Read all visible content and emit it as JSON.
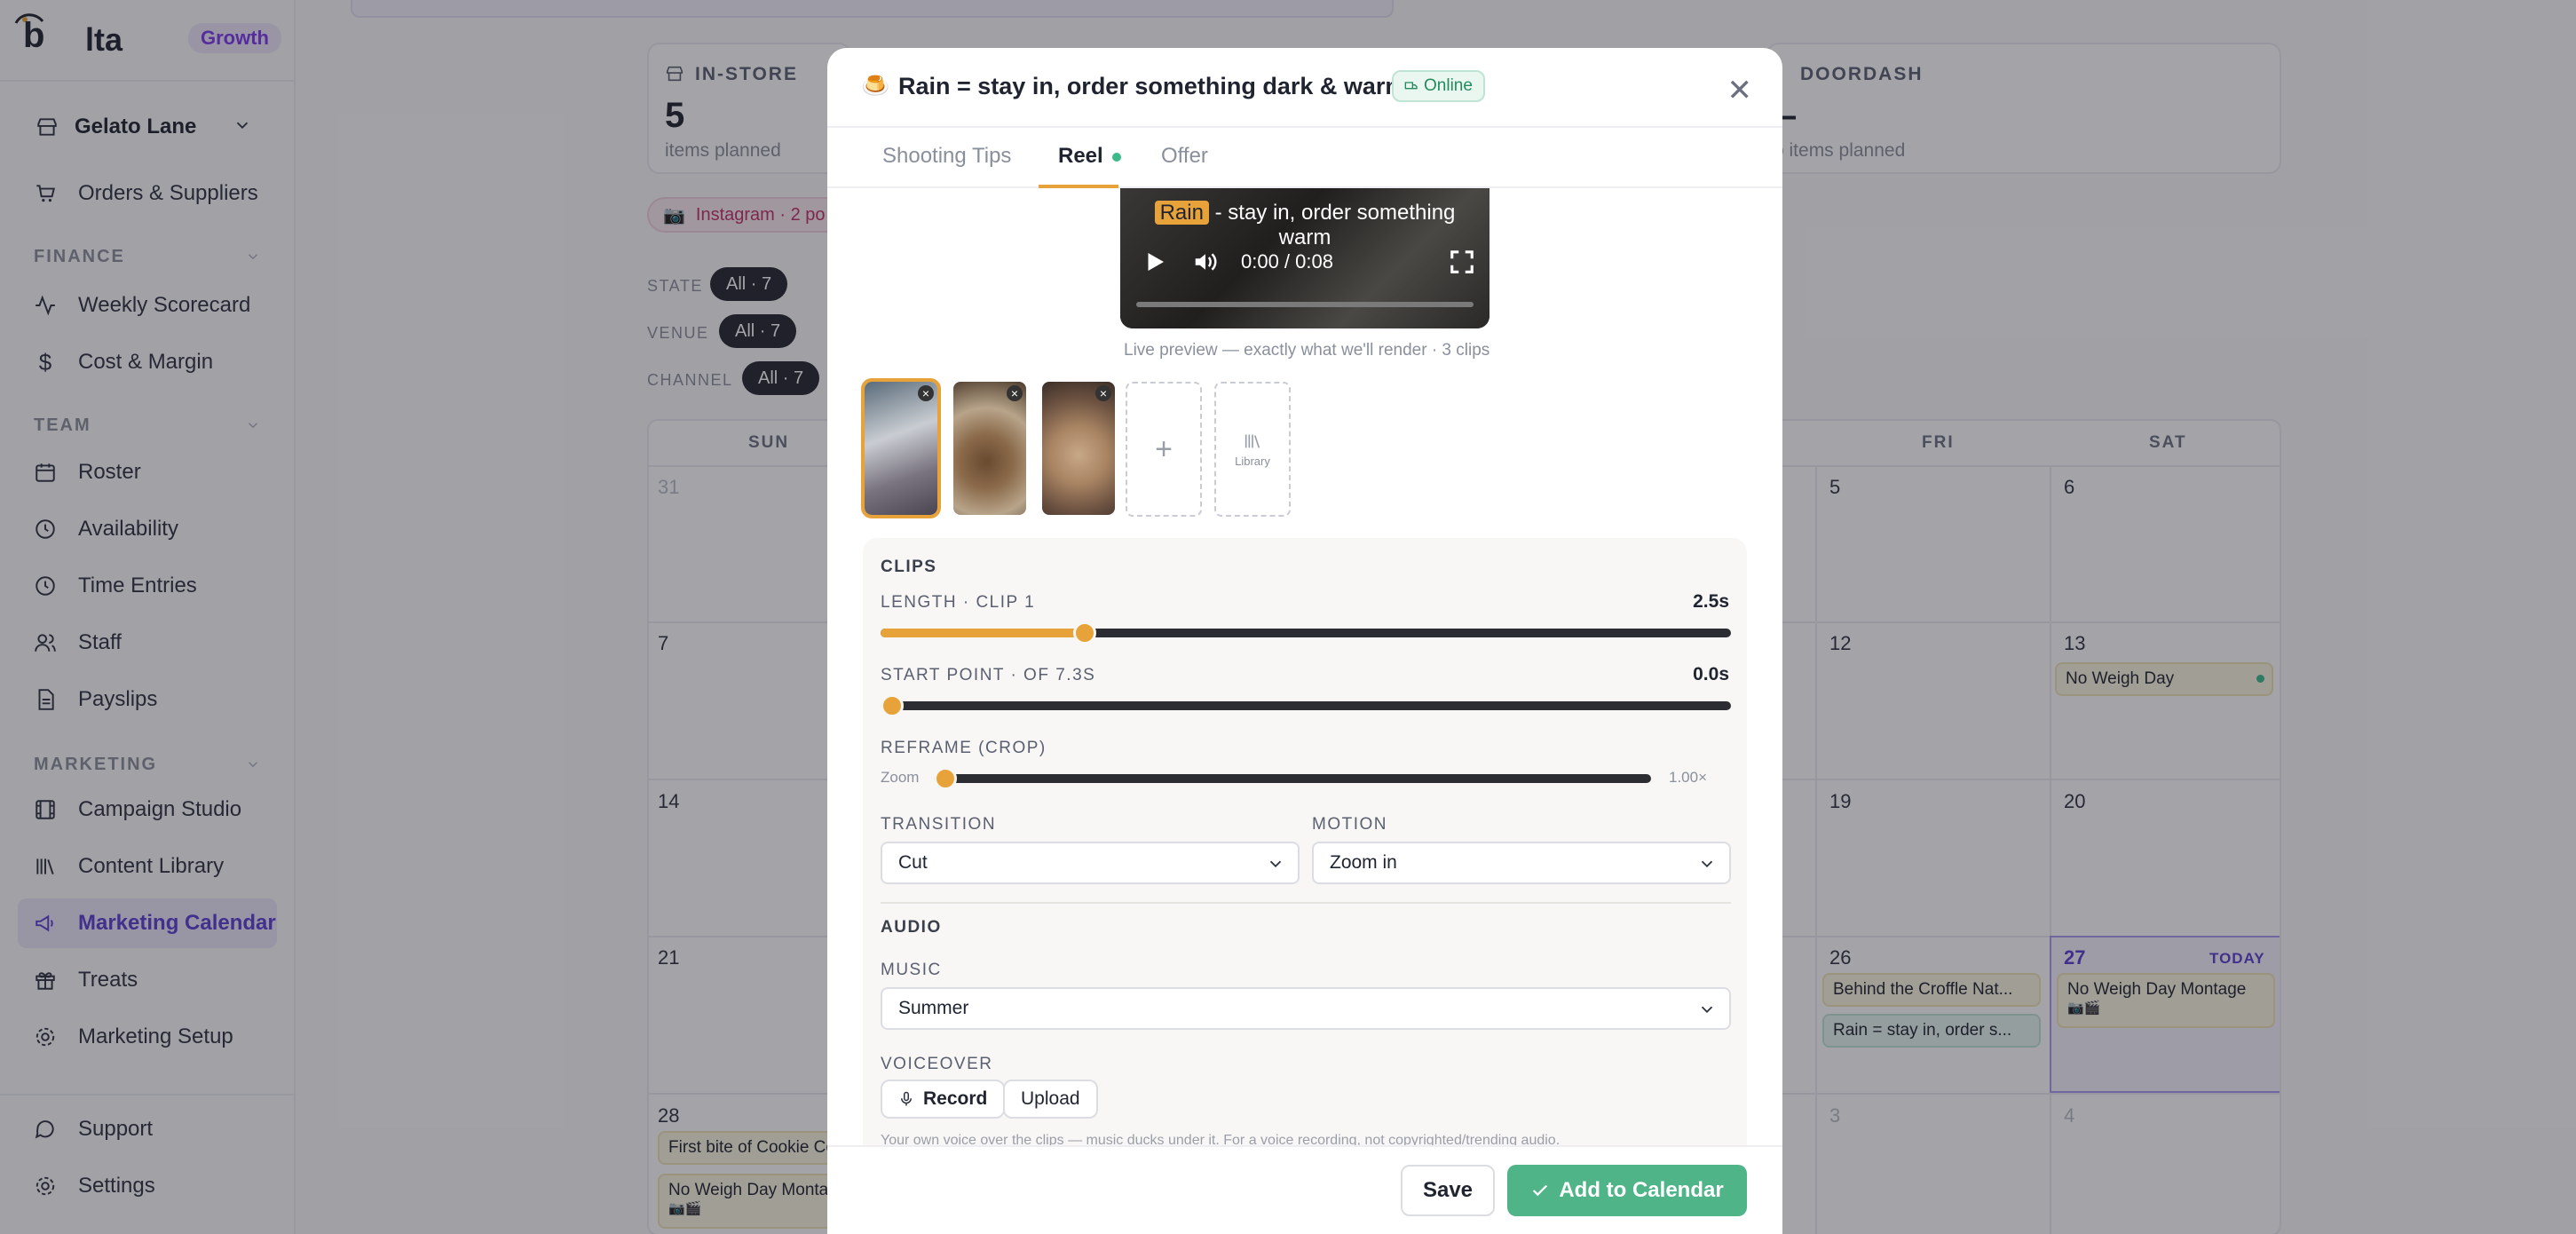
{
  "brand": {
    "name": "lta",
    "plan": "Growth"
  },
  "venue": "Gelato Lane",
  "nav": {
    "orders": "Orders & Suppliers",
    "finance_label": "FINANCE",
    "weekly": "Weekly Scorecard",
    "cost": "Cost & Margin",
    "team_label": "TEAM",
    "roster": "Roster",
    "availability": "Availability",
    "time": "Time Entries",
    "staff": "Staff",
    "payslips": "Payslips",
    "marketing_label": "MARKETING",
    "campaign": "Campaign Studio",
    "library": "Content Library",
    "calendar": "Marketing Calendar",
    "treats": "Treats",
    "setup": "Marketing Setup",
    "support": "Support",
    "settings": "Settings"
  },
  "background": {
    "instore": {
      "title": "IN-STORE",
      "count": "5",
      "sub": "items planned"
    },
    "doordash": {
      "title": "DOORDASH",
      "count": "–",
      "sub": "o items planned"
    },
    "instagram": "Instagram · 2 po",
    "filters": {
      "state": "STATE",
      "venue": "VENUE",
      "channel": "CHANNEL",
      "all_state": "All · 7",
      "all_venue": "All · 7",
      "all_channel": "All · 7"
    },
    "days": {
      "sun": "SUN",
      "fri": "FRI",
      "sat": "SAT"
    },
    "nums": [
      "31",
      "5",
      "6",
      "7",
      "12",
      "13",
      "14",
      "19",
      "20",
      "21",
      "26",
      "27",
      "28",
      "3",
      "4"
    ],
    "today": "TODAY",
    "events": {
      "no_weigh_13": "No Weigh Day",
      "croffle": "Behind the Croffle Nat...",
      "rain_26": "Rain = stay in, order s...",
      "montage_27": "No Weigh Day Montage",
      "cookie_28": "First bite of Cookie Co",
      "montage_28": "No Weigh Day Montag",
      "icons": "📷🎬"
    }
  },
  "modal": {
    "emoji": "🍮",
    "title": "Rain = stay in, order something dark & warm",
    "status": "Online",
    "tabs": [
      "Shooting Tips",
      "Reel",
      "Offer"
    ],
    "video": {
      "caption_hl": "Rain",
      "caption_rest": " - stay in, order something",
      "caption_line2": "warm",
      "time": "0:00 / 0:08"
    },
    "preview_note": "Live preview — exactly what we'll render · 3 clips",
    "library_label": "Library",
    "clips_label": "CLIPS",
    "length_label": "LENGTH · CLIP 1",
    "length_value": "2.5s",
    "length_fraction": 0.24,
    "start_label": "START POINT · OF 7.3S",
    "start_value": "0.0s",
    "start_fraction": 0.0,
    "reframe_label": "REFRAME (CROP)",
    "zoom_label": "Zoom",
    "zoom_value": "1.00×",
    "zoom_fraction": 0.0,
    "transition_label": "TRANSITION",
    "transition_value": "Cut",
    "motion_label": "MOTION",
    "motion_value": "Zoom in",
    "audio_label": "AUDIO",
    "music_label": "MUSIC",
    "music_value": "Summer",
    "voiceover_label": "VOICEOVER",
    "record": "Record",
    "upload": "Upload",
    "voice_note": "Your own voice over the clips — music ducks under it. For a voice recording, not copyrighted/trending audio.",
    "save": "Save",
    "add": "Add to Calendar"
  },
  "colors": {
    "accent": "#e8a23a",
    "brand": "#5b3fd1",
    "green": "#4fb487"
  }
}
